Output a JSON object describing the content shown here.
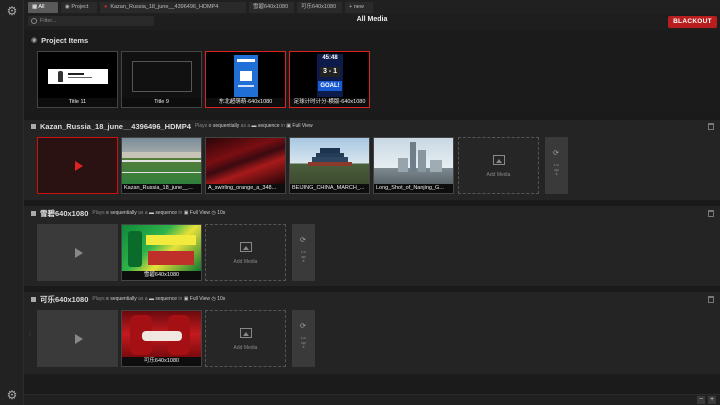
{
  "tabs": [
    {
      "label": "All",
      "icon": "grid-icon",
      "active": true
    },
    {
      "label": "Project",
      "icon": "project-icon"
    },
    {
      "label": "Kazan_Russia_18_june__4396496_HDMP4",
      "icon": "recording-dot-icon"
    },
    {
      "label": "雪碧640x1080"
    },
    {
      "label": "可乐640x1080"
    },
    {
      "label": "+ new"
    }
  ],
  "toolbar": {
    "filter_placeholder": "Filter...",
    "title": "All Media",
    "blackout_label": "BLACKOUT",
    "accent_color": "#b81e1e"
  },
  "project_items": {
    "title": "Project Items",
    "items": [
      {
        "caption": "Title 11"
      },
      {
        "caption": "Title 9"
      },
      {
        "caption": "东北超萌萌-640x1080",
        "selected": true
      },
      {
        "caption": "足球计时计分-横版-640x1080",
        "selected": true,
        "score_home": "3",
        "score_away": "1",
        "clock": "45:48",
        "banner": "GOAL!"
      }
    ]
  },
  "sequences": [
    {
      "title": "Kazan_Russia_18_june__4396496_HDMP4",
      "plays": "Plays",
      "mode": "sequentially",
      "as_a": "as a",
      "type": "sequence",
      "in": "in",
      "view": "Full View",
      "items": [
        {
          "caption": "Kazan_Russia_18_june__..."
        },
        {
          "caption": "A_swirling_orange_a_348..."
        },
        {
          "caption": "BEIJING_CHINA_MARCH_..."
        },
        {
          "caption": "Long_Shot_of_Nanjing_G..."
        }
      ],
      "add_media_label": "Add Media",
      "loop_label": "Loops"
    },
    {
      "title": "雪碧640x1080",
      "plays": "Plays",
      "mode": "sequentially",
      "as_a": "as a",
      "type": "sequence",
      "in": "in",
      "view": "Full View",
      "duration": "10s",
      "items": [
        {
          "caption": "雪碧640x1080"
        }
      ],
      "add_media_label": "Add Media",
      "loop_label": "Loops"
    },
    {
      "title": "可乐640x1080",
      "plays": "Plays",
      "mode": "sequentially",
      "as_a": "as a",
      "type": "sequence",
      "in": "in",
      "view": "Full View",
      "duration": "10s",
      "items": [
        {
          "caption": "可乐640x1080"
        }
      ],
      "add_media_label": "Add Media",
      "loop_label": "Loops"
    }
  ],
  "zoom": {
    "minus": "−",
    "plus": "+"
  }
}
